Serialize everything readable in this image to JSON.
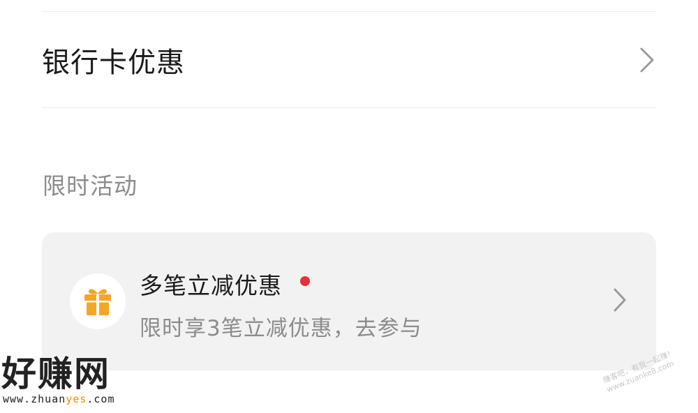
{
  "bank_row": {
    "label": "银行卡优惠",
    "chevron_icon": "chevron-right-icon"
  },
  "section": {
    "title": "限时活动"
  },
  "promo": {
    "icon": "gift-icon",
    "title": "多笔立减优惠",
    "subtitle": "限时享3笔立减优惠，去参与",
    "dot_color": "#e8303a",
    "chevron_icon": "chevron-right-icon"
  },
  "watermark": {
    "logo": "好赚网",
    "url_prefix": "www.zhuan",
    "url_highlight": "yes",
    "url_suffix": ".com",
    "diagonal_line1": "赚客吧，有我一起赚！",
    "diagonal_line2": "www.zuanke8.com"
  },
  "colors": {
    "gift": "#f5a623",
    "card_bg": "#f2f2f2",
    "secondary_text": "#8c8c8c"
  }
}
